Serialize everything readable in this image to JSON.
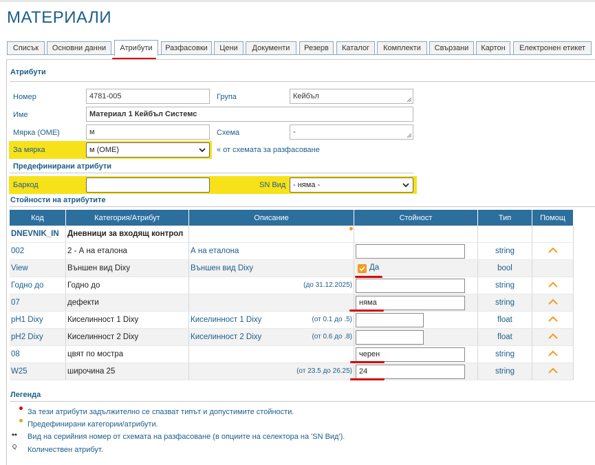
{
  "page": {
    "title": "МАТЕРИАЛИ"
  },
  "tabs": [
    "Списък",
    "Основни данни",
    "Атрибути",
    "Разфасовки",
    "Цени",
    "Документи",
    "Резерв",
    "Каталог",
    "Комплекти",
    "Свързани",
    "Картон",
    "Електронен етикет"
  ],
  "active_tab": "Атрибути",
  "attributes": {
    "section_title": "Атрибути",
    "number_label": "Номер",
    "number_value": "4781-005",
    "group_label": "Група",
    "group_value": "Кейбъл",
    "name_label": "Име",
    "name_value": "Материал 1 Кейбъл Системс",
    "unit_label": "Мярка (ОМЕ)",
    "unit_value": "м",
    "schema_label": "Схема",
    "schema_value": "-",
    "for_unit_label": "За мярка",
    "for_unit_value": "м (ОМЕ)",
    "for_unit_hint": "« от схемата за разфасоване"
  },
  "predefined": {
    "section_title": "Предефинирани атрибути",
    "barcode_label": "Баркод",
    "barcode_value": "",
    "sn_label": "SN Вид",
    "sn_value": "- няма -"
  },
  "values_section": {
    "title": "Стойности на атрибутите",
    "columns": [
      "Код",
      "Категория/Атрибут",
      "Описание",
      "Стойност",
      "Тип",
      "Помощ"
    ],
    "group_row": {
      "code": "DNEVNIK_IN",
      "category": "Дневници за входящ контрол"
    },
    "rows": [
      {
        "code": "002",
        "category": "2 - А на еталона",
        "description": "А на еталона",
        "range": "",
        "value": "",
        "type": "string",
        "help": true
      },
      {
        "code": "View",
        "category": "Външен вид Dixy",
        "description": "Външен вид Dixy",
        "range": "",
        "value": "Да",
        "type": "bool",
        "help": false
      },
      {
        "code": "Годно до",
        "category": "Годно до",
        "description": "",
        "range": "(до 31.12.2025)",
        "value": "",
        "type": "string",
        "help": true
      },
      {
        "code": "07",
        "category": "дефекти",
        "description": "",
        "range": "",
        "value": "няма",
        "type": "string",
        "help": true
      },
      {
        "code": "pH1 Dixy",
        "category": "Киселинност 1 Dixy",
        "description": "Киселинност 1 Dixy",
        "range": "(от 0.1 до .5)",
        "value": "",
        "type": "float",
        "help": true
      },
      {
        "code": "pH2 Dixy",
        "category": "Киселинност 2 Dixy",
        "description": "Киселинност 2 Dixy",
        "range": "(от 0.6 до .8)",
        "value": "",
        "type": "float",
        "help": true
      },
      {
        "code": "08",
        "category": "цвят по мостра",
        "description": "",
        "range": "",
        "value": "черен",
        "type": "string",
        "help": true
      },
      {
        "code": "W25",
        "category": "широчина 25",
        "description": "",
        "range": "(от 23.5 до 26.25)",
        "value": "24",
        "type": "string",
        "help": true
      }
    ]
  },
  "legend": {
    "title": "Легенда",
    "items": [
      {
        "symbol": "red-dot",
        "text": "За тези атрибути задължително се спазват типът и допустимите стойности."
      },
      {
        "symbol": "orange-dot",
        "text": "Предефинирани категории/атрибути."
      },
      {
        "symbol": "**",
        "text": "Вид на серийния номер от схемата на разфасоване (в опциите на селектора на 'SN Вид')."
      },
      {
        "symbol": "Q",
        "text": "Количествен атрибут."
      }
    ]
  },
  "colors": {
    "accent": "#1b5d8a",
    "header_bg": "#2c6e9c",
    "highlight": "#f7e21a",
    "annotation": "#d80000",
    "orange": "#f29c1f"
  }
}
